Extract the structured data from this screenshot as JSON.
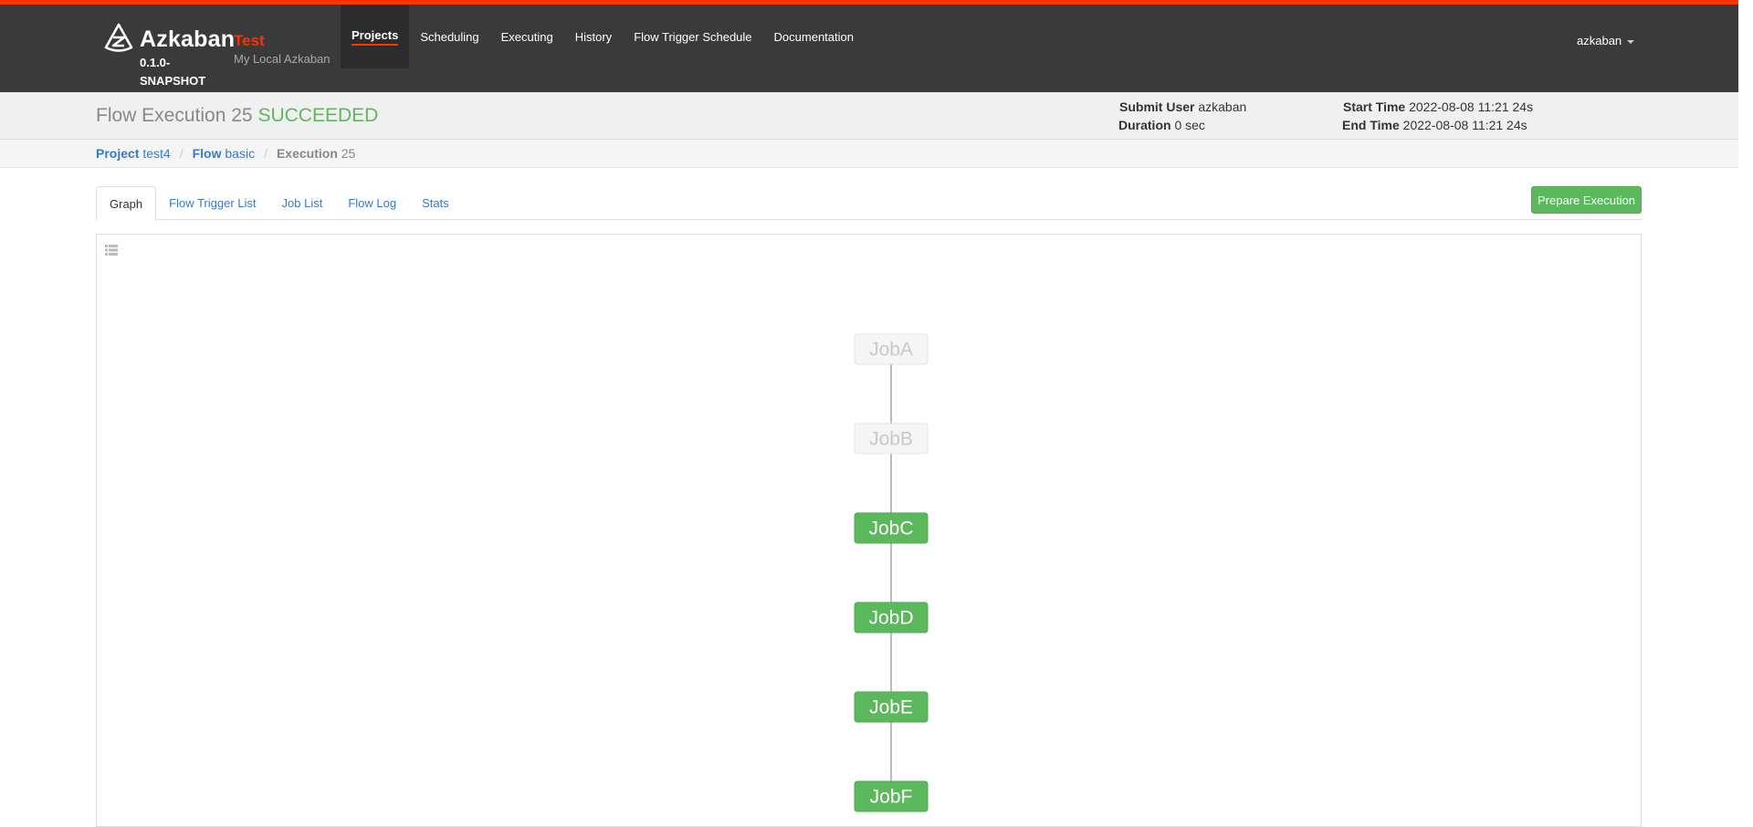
{
  "brand": {
    "name": "Azkaban",
    "version": "0.1.0-SNAPSHOT"
  },
  "environment": {
    "name": "Test",
    "description": "My Local Azkaban"
  },
  "nav": [
    {
      "label": "Projects",
      "active": true
    },
    {
      "label": "Scheduling",
      "active": false
    },
    {
      "label": "Executing",
      "active": false
    },
    {
      "label": "History",
      "active": false
    },
    {
      "label": "Flow Trigger Schedule",
      "active": false
    },
    {
      "label": "Documentation",
      "active": false
    }
  ],
  "user": {
    "name": "azkaban"
  },
  "execution": {
    "title_prefix": "Flow Execution 25",
    "status": "SUCCEEDED",
    "submit_user_label": "Submit User",
    "submit_user": "azkaban",
    "duration_label": "Duration",
    "duration": "0 sec",
    "start_time_label": "Start Time",
    "start_time": "2022-08-08 11:21 24s",
    "end_time_label": "End Time",
    "end_time": "2022-08-08 11:21 24s"
  },
  "breadcrumb": {
    "project_label": "Project",
    "project": "test4",
    "flow_label": "Flow",
    "flow": "basic",
    "execution_label": "Execution",
    "execution": "25"
  },
  "tabs": [
    {
      "label": "Graph",
      "active": true
    },
    {
      "label": "Flow Trigger List",
      "active": false
    },
    {
      "label": "Job List",
      "active": false
    },
    {
      "label": "Flow Log",
      "active": false
    },
    {
      "label": "Stats",
      "active": false
    }
  ],
  "prepare_execution_label": "Prepare Execution",
  "graph": {
    "nodes": [
      {
        "id": "JobA",
        "status": "disabled"
      },
      {
        "id": "JobB",
        "status": "disabled"
      },
      {
        "id": "JobC",
        "status": "succeeded"
      },
      {
        "id": "JobD",
        "status": "succeeded"
      },
      {
        "id": "JobE",
        "status": "succeeded"
      },
      {
        "id": "JobF",
        "status": "succeeded"
      }
    ],
    "colors": {
      "succeeded_fill": "#5cb85c",
      "succeeded_stroke": "#4cae4c",
      "disabled_fill": "#f5f5f5",
      "disabled_stroke": "#e5e5e5",
      "disabled_text": "#c8c8c8",
      "edge": "#bbbbbb"
    }
  }
}
